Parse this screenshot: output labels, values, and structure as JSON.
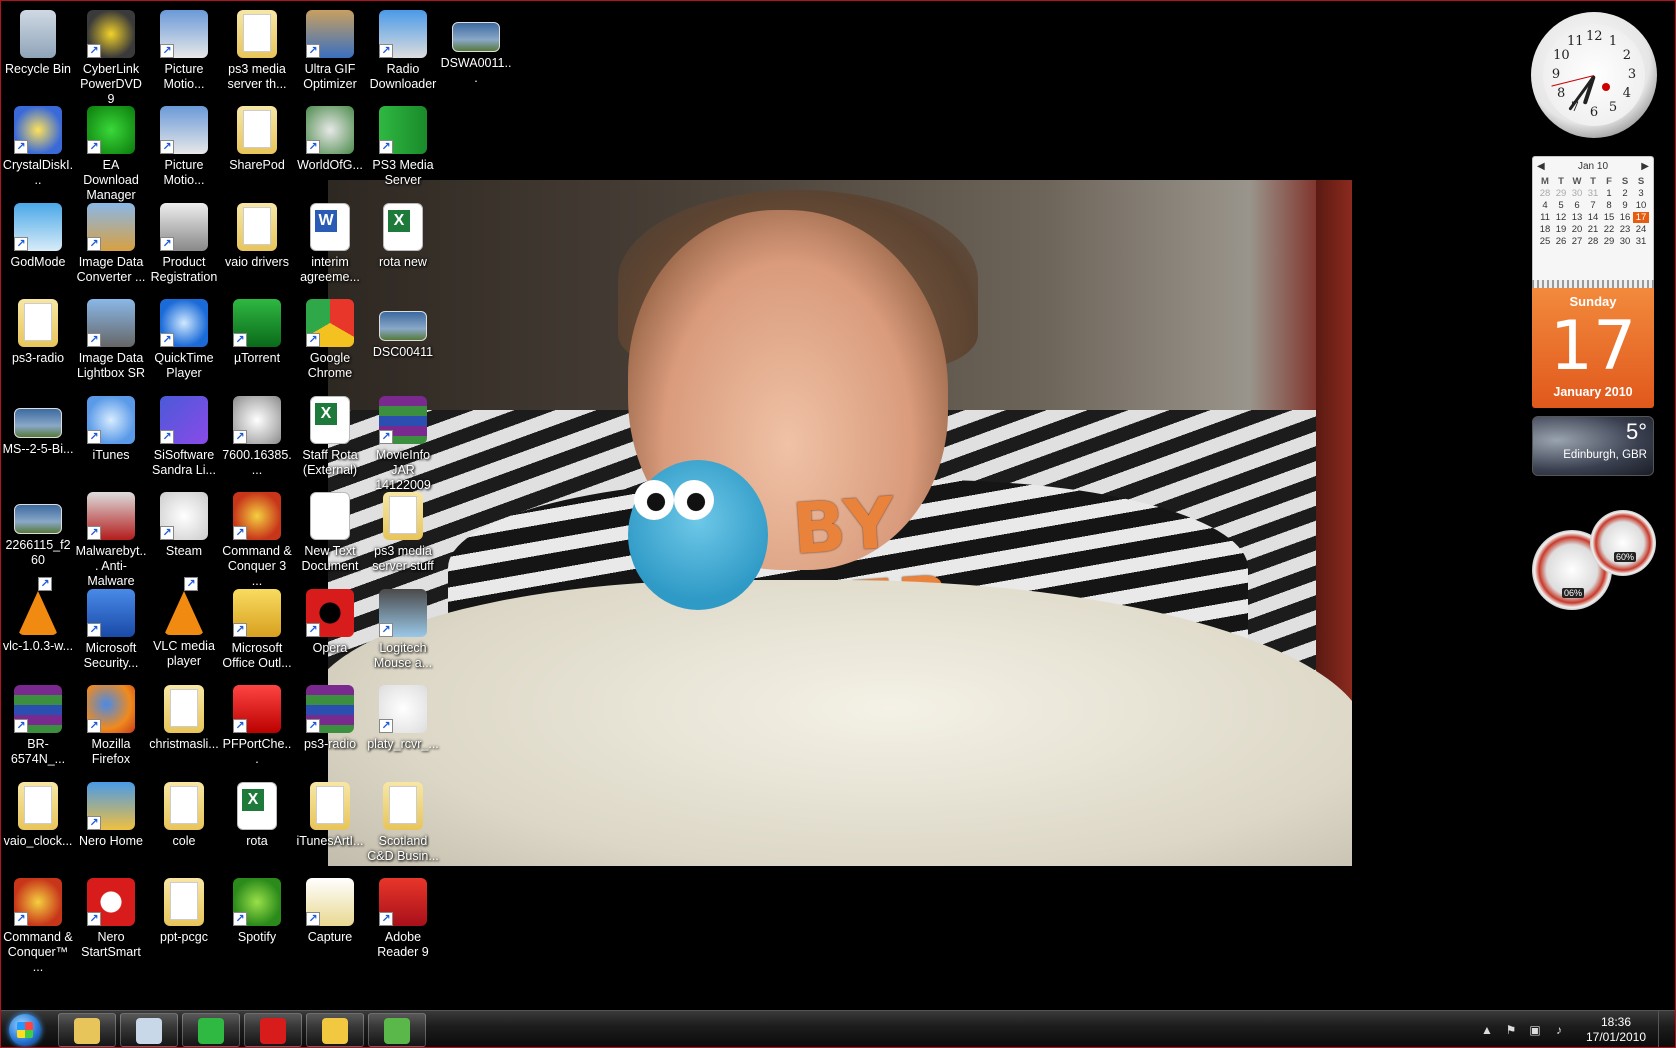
{
  "desktop": {
    "icons": [
      {
        "label": "Recycle Bin",
        "icon": "recycle-bin-icon"
      },
      {
        "label": "CyberLink PowerDVD 9",
        "icon": "powerdvd-icon"
      },
      {
        "label": "Picture Motio...",
        "icon": "picture-motion-icon"
      },
      {
        "label": "ps3 media server th...",
        "icon": "folder-icon"
      },
      {
        "label": "Ultra GIF Optimizer",
        "icon": "gif-optimizer-icon"
      },
      {
        "label": "Radio Downloader",
        "icon": "radio-downloader-icon"
      },
      {
        "label": "DSWA0011...",
        "icon": "photo-icon"
      },
      {
        "label": "CrystalDiskI...",
        "icon": "crystaldisk-icon"
      },
      {
        "label": "EA Download Manager",
        "icon": "ea-icon"
      },
      {
        "label": "Picture Motio...",
        "icon": "picture-motion-icon"
      },
      {
        "label": "SharePod",
        "icon": "folder-icon"
      },
      {
        "label": "WorldOfG...",
        "icon": "wow-icon"
      },
      {
        "label": "PS3 Media Server",
        "icon": "play-icon"
      },
      {
        "label": "GodMode",
        "icon": "godmode-icon"
      },
      {
        "label": "Image Data Converter ...",
        "icon": "image-data-icon"
      },
      {
        "label": "Product Registration",
        "icon": "product-registration-icon"
      },
      {
        "label": "vaio drivers",
        "icon": "folder-icon"
      },
      {
        "label": "interim agreeme...",
        "icon": "word-doc-icon"
      },
      {
        "label": "rota new",
        "icon": "excel-doc-icon"
      },
      {
        "label": "ps3-radio",
        "icon": "folder-icon"
      },
      {
        "label": "Image Data Lightbox SR",
        "icon": "image-lightbox-icon"
      },
      {
        "label": "QuickTime Player",
        "icon": "quicktime-icon"
      },
      {
        "label": "µTorrent",
        "icon": "utorrent-icon"
      },
      {
        "label": "Google Chrome",
        "icon": "chrome-icon"
      },
      {
        "label": "DSC00411",
        "icon": "photo-icon"
      },
      {
        "label": "MS--2-5-Bi...",
        "icon": "photo-icon"
      },
      {
        "label": "iTunes",
        "icon": "itunes-icon"
      },
      {
        "label": "SiSoftware Sandra Li...",
        "icon": "sandra-icon"
      },
      {
        "label": "7600.16385....",
        "icon": "disc-image-icon"
      },
      {
        "label": "Staff Rota (External)",
        "icon": "excel-doc-icon"
      },
      {
        "label": "MovieInfo JAR 14122009",
        "icon": "rar-icon"
      },
      {
        "label": "2266115_f260",
        "icon": "photo-icon"
      },
      {
        "label": "Malwarebyt... Anti-Malware",
        "icon": "malwarebytes-icon"
      },
      {
        "label": "Steam",
        "icon": "steam-icon"
      },
      {
        "label": "Command & Conquer 3 ...",
        "icon": "cnc-icon"
      },
      {
        "label": "New Text Document",
        "icon": "text-doc-icon"
      },
      {
        "label": "ps3 media server stuff",
        "icon": "folder-icon"
      },
      {
        "label": "vlc-1.0.3-w...",
        "icon": "vlc-icon"
      },
      {
        "label": "Microsoft Security...",
        "icon": "ms-security-icon"
      },
      {
        "label": "VLC media player",
        "icon": "vlc-icon"
      },
      {
        "label": "Microsoft Office Outl...",
        "icon": "outlook-icon"
      },
      {
        "label": "Opera",
        "icon": "opera-icon"
      },
      {
        "label": "Logitech Mouse a...",
        "icon": "logitech-mouse-icon"
      },
      {
        "label": "BR-6574N_...",
        "icon": "rar-icon"
      },
      {
        "label": "Mozilla Firefox",
        "icon": "firefox-icon"
      },
      {
        "label": "christmasli...",
        "icon": "pdf-doc-icon"
      },
      {
        "label": "PFPortChe...",
        "icon": "pfportchecker-icon"
      },
      {
        "label": "ps3-radio",
        "icon": "rar-icon"
      },
      {
        "label": "platy_rcvr_...",
        "icon": "logitech-icon"
      },
      {
        "label": "vaio_clock...",
        "icon": "folder-icon"
      },
      {
        "label": "Nero Home",
        "icon": "nero-home-icon"
      },
      {
        "label": "cole",
        "icon": "folder-icon"
      },
      {
        "label": "rota",
        "icon": "excel-doc-icon"
      },
      {
        "label": "iTunesArtI...",
        "icon": "folder-icon"
      },
      {
        "label": "Scotland C&D Busin...",
        "icon": "folder-icon"
      },
      {
        "label": "Command & Conquer™ ...",
        "icon": "cnc-icon"
      },
      {
        "label": "Nero StartSmart",
        "icon": "nero-icon"
      },
      {
        "label": "ppt-pcgc",
        "icon": "folder-icon"
      },
      {
        "label": "Spotify",
        "icon": "spotify-icon"
      },
      {
        "label": "Capture",
        "icon": "image-file-icon"
      },
      {
        "label": "Adobe Reader 9",
        "icon": "adobe-reader-icon"
      }
    ]
  },
  "gadgets": {
    "clock": {
      "numbers": [
        "12",
        "1",
        "2",
        "3",
        "4",
        "5",
        "6",
        "7",
        "8",
        "9",
        "10",
        "11"
      ],
      "time_hour": 6,
      "time_minute": 36
    },
    "calendar": {
      "month_label": "Jan 10",
      "prev": "◀",
      "next": "▶",
      "weekdays": [
        "M",
        "T",
        "W",
        "T",
        "F",
        "S",
        "S"
      ],
      "days": [
        "28",
        "29",
        "30",
        "31",
        "1",
        "2",
        "3",
        "4",
        "5",
        "6",
        "7",
        "8",
        "9",
        "10",
        "11",
        "12",
        "13",
        "14",
        "15",
        "16",
        "17",
        "18",
        "19",
        "20",
        "21",
        "22",
        "23",
        "24",
        "25",
        "26",
        "27",
        "28",
        "29",
        "30",
        "31"
      ],
      "today": "17",
      "day_of_week": "Sunday",
      "day_number": "17",
      "month_year": "January 2010"
    },
    "weather": {
      "temp": "5°",
      "location": "Edinburgh, GBR"
    },
    "meters": {
      "cpu": "06%",
      "memory": "60%"
    }
  },
  "taskbar": {
    "buttons": [
      {
        "name": "explorer",
        "icon": "folder-icon",
        "color": "#e8c55a"
      },
      {
        "name": "snipping",
        "icon": "scissors-icon",
        "color": "#c8d8e8"
      },
      {
        "name": "ps3-media-server",
        "icon": "play-icon",
        "color": "#2fb842"
      },
      {
        "name": "opera",
        "icon": "opera-icon",
        "color": "#d81c1c"
      },
      {
        "name": "outlook",
        "icon": "outlook-icon",
        "color": "#f2c840"
      },
      {
        "name": "windows-live-messenger",
        "icon": "messenger-icon",
        "color": "#5ab84a"
      }
    ],
    "clock_time": "18:36",
    "clock_date": "17/01/2010"
  },
  "colors": {
    "accent": "#b4121c",
    "calendar_orange": "#e65c10"
  }
}
